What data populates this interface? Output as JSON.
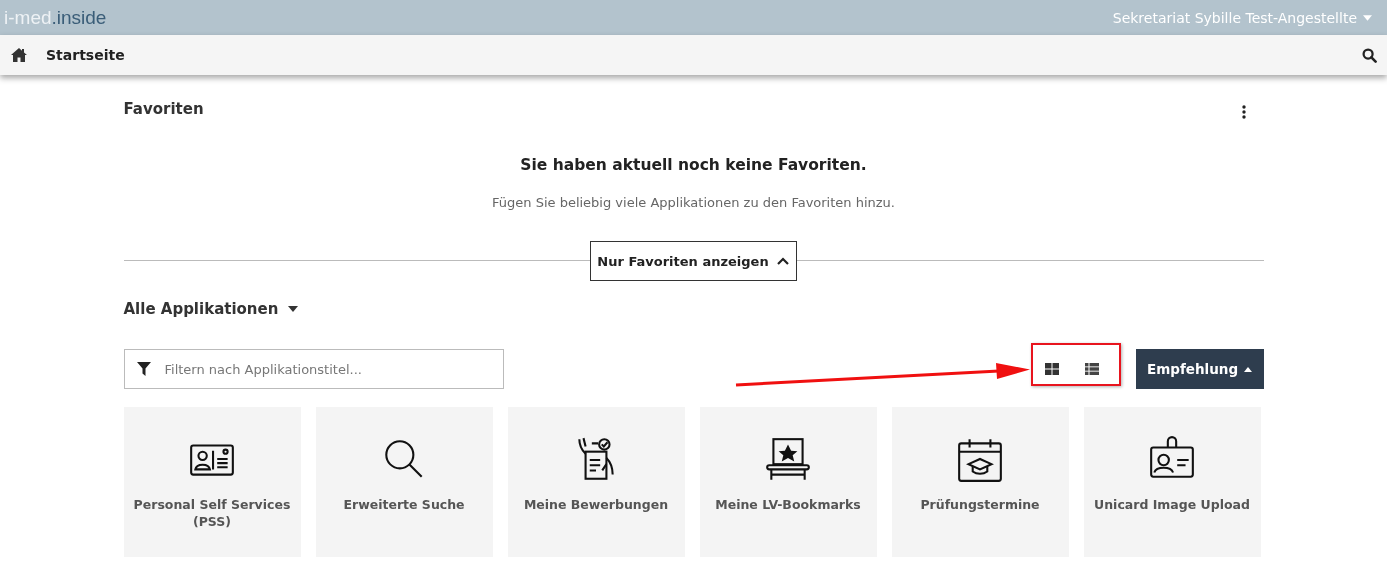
{
  "header": {
    "logo": {
      "part_1": "i-med",
      "part_2": ".inside"
    },
    "user": "Sekretariat Sybille Test-Angestellte"
  },
  "nav": {
    "title": "Startseite"
  },
  "favorites": {
    "title": "Favoriten",
    "empty_title": "Sie haben aktuell noch keine Favoriten.",
    "empty_text": "Fügen Sie beliebig viele Applikationen zu den Favoriten hinzu.",
    "toggle_button": "Nur Favoriten anzeigen"
  },
  "applications": {
    "title": "Alle Applikationen",
    "filter": {
      "placeholder": "Filtern nach Applikationstitel..."
    },
    "sort_button": "Empfehlung",
    "cards": [
      {
        "kind": "id-card",
        "title": "Personal Self Services (PSS)"
      },
      {
        "kind": "search",
        "title": "Erweiterte Suche"
      },
      {
        "kind": "application",
        "title": "Meine Bewerbungen"
      },
      {
        "kind": "bookmark",
        "title": "Meine LV-Bookmarks"
      },
      {
        "kind": "calendar",
        "title": "Prüfungstermine"
      },
      {
        "kind": "badge",
        "title": "Unicard Image Upload"
      }
    ]
  }
}
